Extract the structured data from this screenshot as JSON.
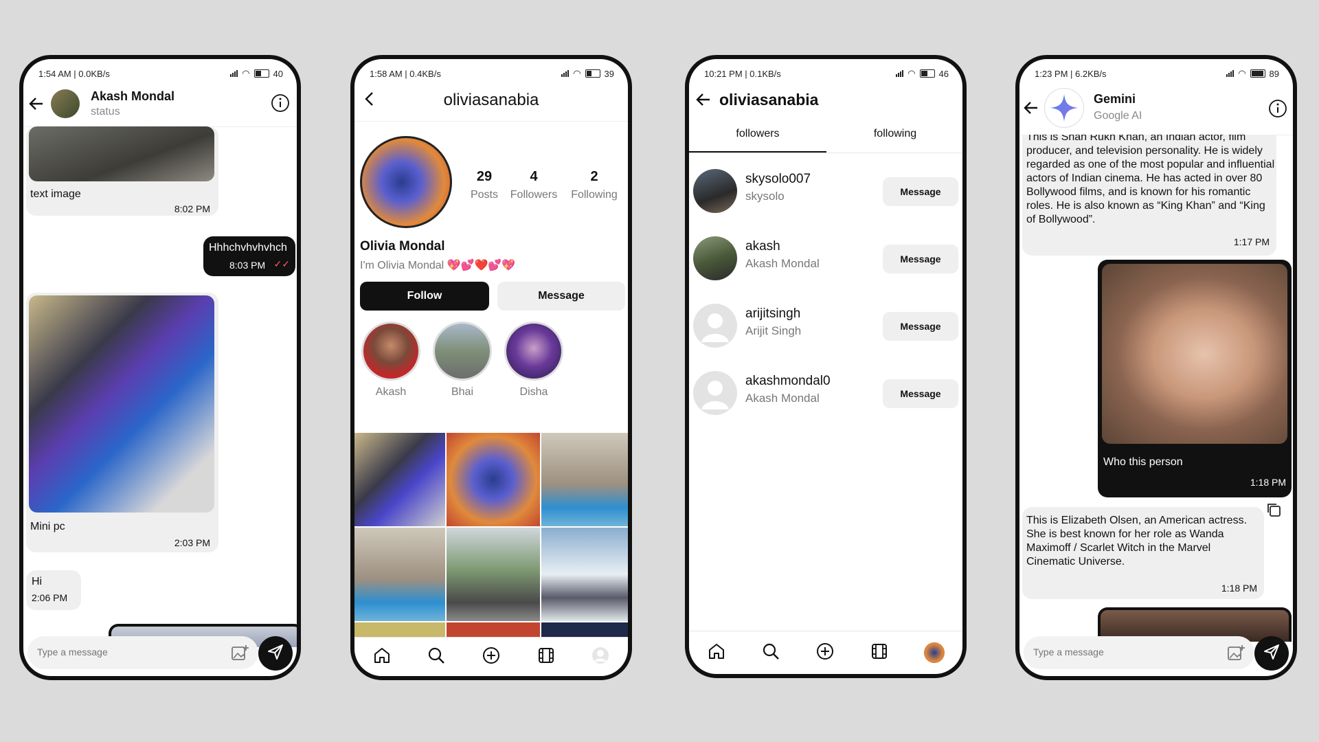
{
  "phone1": {
    "status": {
      "left": "1:54 AM | 0.0KB/s",
      "battery": "40"
    },
    "header": {
      "name": "Akash Mondal",
      "subtitle": "status"
    },
    "messages": [
      {
        "text": "text image",
        "time": "8:02 PM"
      },
      {
        "text": "Hhhchvhvhvhch",
        "time": "8:03 PM"
      },
      {
        "text": "Mini pc",
        "time": "2:03 PM"
      },
      {
        "text": "Hi",
        "time": "2:06 PM"
      }
    ],
    "input_placeholder": "Type a message"
  },
  "phone2": {
    "status": {
      "left": "1:58 AM | 0.4KB/s",
      "battery": "39"
    },
    "username": "oliviasanabia",
    "stats": [
      {
        "value": "29",
        "label": "Posts"
      },
      {
        "value": "4",
        "label": "Followers"
      },
      {
        "value": "2",
        "label": "Following"
      }
    ],
    "name": "Olivia Mondal",
    "bio": "I'm Olivia Mondal 💖💕❤️💕💖",
    "follow_label": "Follow",
    "message_label": "Message",
    "highlights": [
      "Akash",
      "Bhai",
      "Disha"
    ]
  },
  "phone3": {
    "status": {
      "left": "10:21 PM | 0.1KB/s",
      "battery": "46"
    },
    "username": "oliviasanabia",
    "tabs": [
      "followers",
      "following"
    ],
    "users": [
      {
        "username": "skysolo007",
        "fullname": "skysolo",
        "button": "Message"
      },
      {
        "username": "akash",
        "fullname": "Akash Mondal",
        "button": "Message"
      },
      {
        "username": "arijitsingh",
        "fullname": "Arijit Singh",
        "button": "Message"
      },
      {
        "username": "akashmondal0",
        "fullname": "Akash Mondal",
        "button": "Message"
      }
    ]
  },
  "phone4": {
    "status": {
      "left": "1:23 PM | 6.2KB/s",
      "battery": "89"
    },
    "header": {
      "name": "Gemini",
      "subtitle": "Google AI"
    },
    "messages": [
      {
        "text": "This is Shah Rukh Khan, an Indian actor, film producer, and television personality. He is widely regarded as one of the most popular and influential actors of Indian cinema. He has acted in over 80 Bollywood films, and is known for his romantic roles. He is also known as “King Khan” and “King of Bollywood”.",
        "time": "1:17 PM"
      },
      {
        "text": "Who this person",
        "time": "1:18 PM"
      },
      {
        "text": "This is Elizabeth Olsen, an American actress. She is best known for her role as Wanda Maximoff / Scarlet Witch in the Marvel Cinematic Universe.",
        "time": "1:18 PM"
      }
    ],
    "input_placeholder": "Type a message"
  }
}
